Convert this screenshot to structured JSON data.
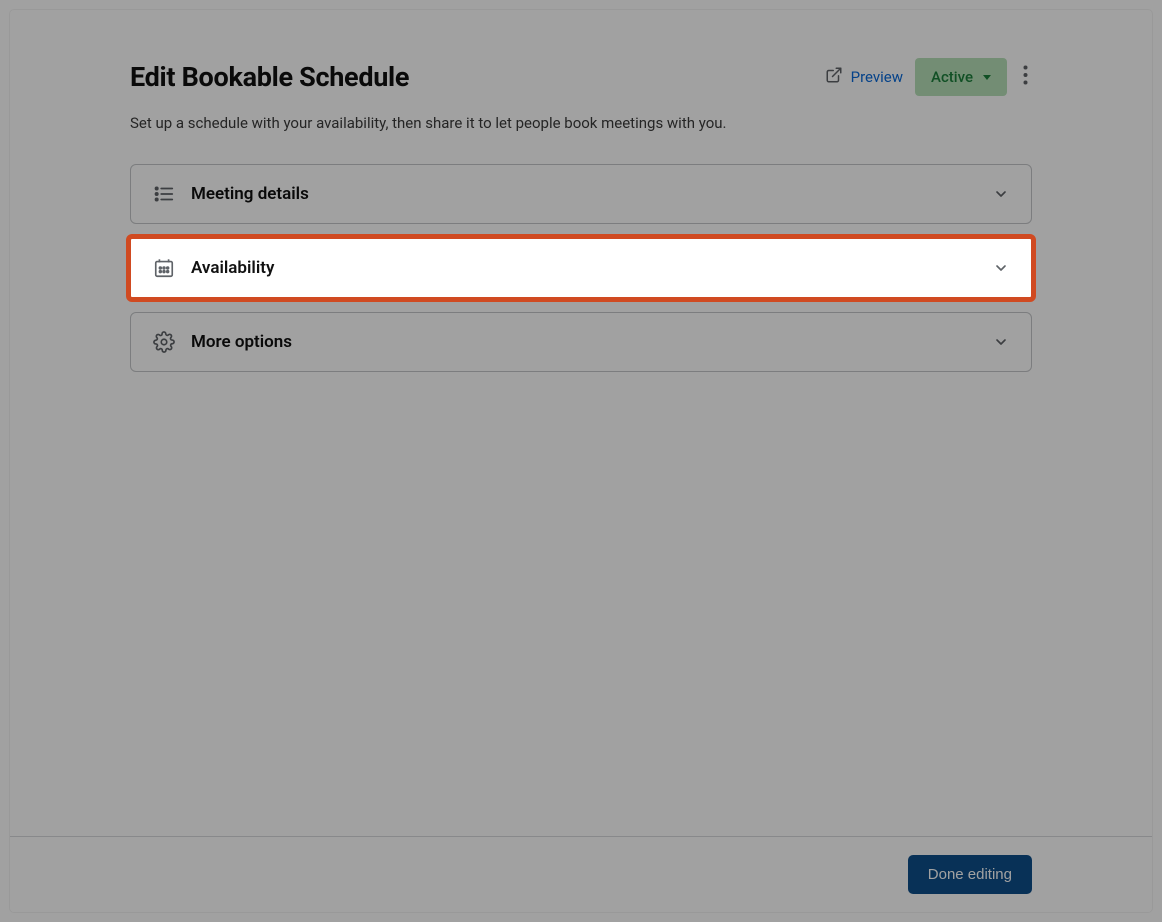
{
  "header": {
    "title": "Edit Bookable Schedule",
    "preview_label": "Preview",
    "status_label": "Active"
  },
  "description": "Set up a schedule with your availability, then share it to let people book meetings with you.",
  "accordions": [
    {
      "label": "Meeting details"
    },
    {
      "label": "Availability"
    },
    {
      "label": "More options"
    }
  ],
  "footer": {
    "done_label": "Done editing"
  }
}
